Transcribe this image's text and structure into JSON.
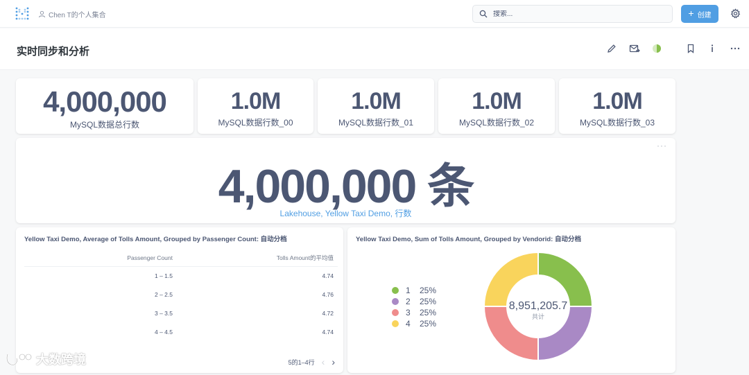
{
  "navbar": {
    "breadcrumb": "Chen T的个人集合",
    "search_placeholder": "搜索...",
    "create_label": "创建",
    "icons": [
      "metabase-logo-icon",
      "person-icon",
      "search-icon",
      "plus-icon",
      "gear-icon"
    ]
  },
  "dashboard": {
    "title": "实时同步和分析",
    "header_icons": [
      "pencil-icon",
      "share-icon",
      "status-icon",
      "bookmark-icon",
      "info-icon",
      "ellipsis-icon"
    ]
  },
  "kpis": [
    {
      "value": "4,000,000",
      "label": "MySQL数据总行数"
    },
    {
      "value": "1.0M",
      "label": "MySQL数据行数_00"
    },
    {
      "value": "1.0M",
      "label": "MySQL数据行数_01"
    },
    {
      "value": "1.0M",
      "label": "MySQL数据行数_02"
    },
    {
      "value": "1.0M",
      "label": "MySQL数据行数_03"
    }
  ],
  "big_number": {
    "value": "4,000,000 条",
    "link": "Lakehouse, Yellow Taxi Demo, 行数",
    "menu": "···"
  },
  "table_card": {
    "title": "Yellow Taxi Demo, Average of Tolls Amount, Grouped by Passenger Count: 自动分档",
    "columns": [
      "Passenger Count",
      "Tolls Amount的平均值"
    ],
    "rows": [
      [
        "1 – 1.5",
        "4.74"
      ],
      [
        "2 – 2.5",
        "4.76"
      ],
      [
        "3 – 3.5",
        "4.72"
      ],
      [
        "4 – 4.5",
        "4.74"
      ]
    ],
    "pager": "5的1–4行",
    "prev_arrow": "‹",
    "next_arrow": "›"
  },
  "chart_data": {
    "type": "pie",
    "title": "Yellow Taxi Demo, Sum of Tolls Amount, Grouped by Vendorid: 自动分档",
    "categories": [
      "1",
      "2",
      "3",
      "4"
    ],
    "values": [
      25,
      25,
      25,
      25
    ],
    "value_labels": [
      "25%",
      "25%",
      "25%",
      "25%"
    ],
    "colors": [
      "#88bf4d",
      "#a989c5",
      "#ef8c8c",
      "#f9d45c"
    ],
    "total": "8,951,205.7",
    "total_label": "共计",
    "legend_position": "left",
    "donut": true
  },
  "watermark": "大数跨境"
}
